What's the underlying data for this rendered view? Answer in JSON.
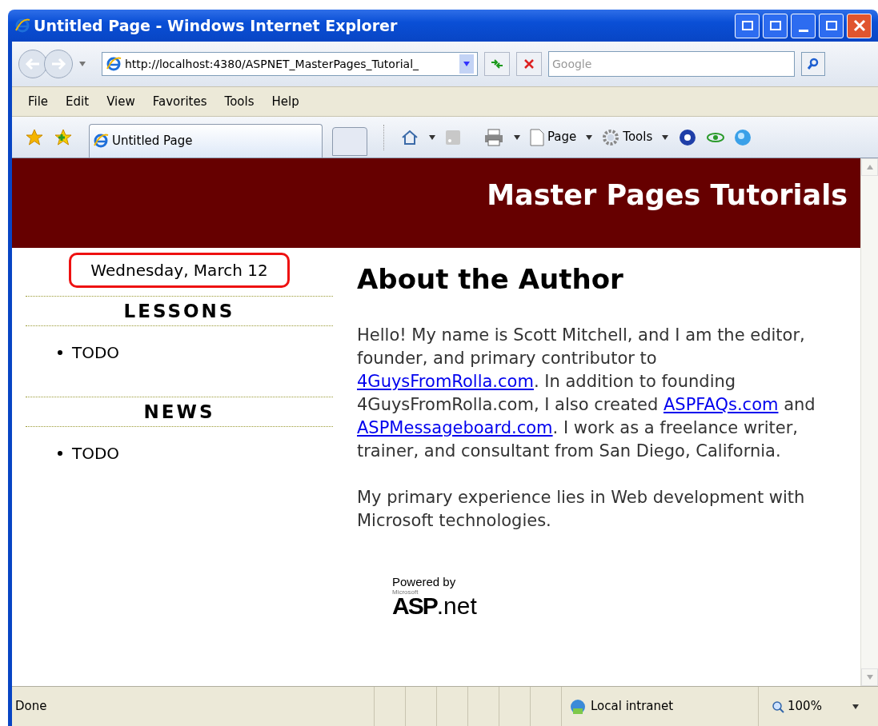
{
  "window": {
    "title": "Untitled Page - Windows Internet Explorer"
  },
  "address": {
    "url": "http://localhost:4380/ASPNET_MasterPages_Tutorial_"
  },
  "search": {
    "placeholder": "Google"
  },
  "menu": [
    "File",
    "Edit",
    "View",
    "Favorites",
    "Tools",
    "Help"
  ],
  "tabs": [
    {
      "label": "Untitled Page",
      "selected": true
    }
  ],
  "toolbar": [
    "Page",
    "Tools"
  ],
  "page": {
    "header": "Master Pages Tutorials",
    "date": "Wednesday, March 12",
    "sections": [
      {
        "title": "LESSONS",
        "items": [
          "TODO"
        ]
      },
      {
        "title": "NEWS",
        "items": [
          "TODO"
        ]
      }
    ],
    "heading": "About the Author",
    "paragraphs": [
      [
        {
          "kind": "text",
          "text": "Hello! My name is Scott Mitchell, and I am the editor, founder, and primary contributor to "
        },
        {
          "kind": "link",
          "text": "4GuysFromRolla.com"
        },
        {
          "kind": "text",
          "text": ". In addition to founding 4GuysFromRolla.com, I also created "
        },
        {
          "kind": "link",
          "text": "ASPFAQs.com"
        },
        {
          "kind": "text",
          "text": " and "
        },
        {
          "kind": "link",
          "text": "ASPMessageboard.com"
        },
        {
          "kind": "text",
          "text": ". I work as a freelance writer, trainer, and consultant from San Diego, California."
        }
      ],
      [
        {
          "kind": "text",
          "text": "My primary experience lies in Web development with Microsoft technologies."
        }
      ]
    ],
    "badge": {
      "powered": "Powered by",
      "maker": "Microsoft",
      "brand": "ASP",
      "suffix": ".net"
    }
  },
  "status_bar": {
    "text": "Done",
    "zone": "Local intranet",
    "zoom": "100%"
  }
}
